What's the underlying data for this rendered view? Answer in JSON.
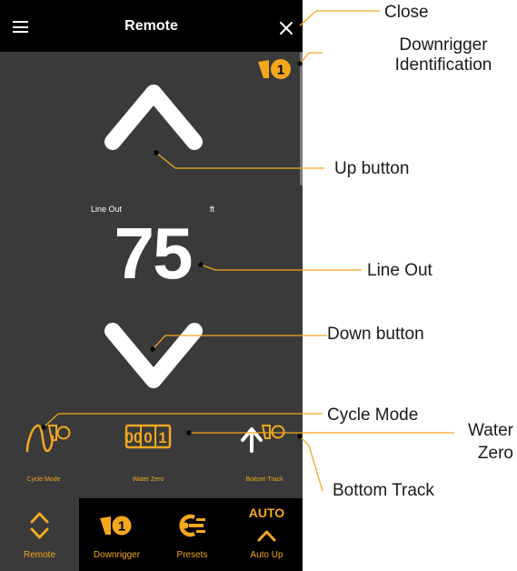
{
  "header": {
    "title": "Remote",
    "menu_icon": "hamburger-icon",
    "close_icon": "close-icon"
  },
  "downrigger_badge": {
    "number": "1"
  },
  "line_out": {
    "label": "Line Out",
    "unit": "ft",
    "value": "75"
  },
  "tools": [
    {
      "label": "Cycle Mode",
      "icon": "cycle-mode-icon"
    },
    {
      "label": "Water Zero",
      "icon": "water-zero-icon",
      "digits": "00",
      "digit_flip": "1"
    },
    {
      "label": "Bottom Track",
      "icon": "bottom-track-icon"
    }
  ],
  "nav": [
    {
      "label": "Remote",
      "icon": "remote-icon",
      "active": true
    },
    {
      "label": "Downrigger",
      "icon": "downrigger-icon",
      "badge": "1"
    },
    {
      "label": "Presets",
      "icon": "presets-icon"
    },
    {
      "label": "Auto Up",
      "icon": "auto-up-icon",
      "text": "AUTO"
    }
  ],
  "callouts": {
    "close": "Close",
    "downrigger_id": "Downrigger Identification",
    "downrigger_id_line1": "Downrigger",
    "downrigger_id_line2": "Identification",
    "up_button": "Up button",
    "line_out": "Line Out",
    "down_button": "Down button",
    "cycle_mode": "Cycle Mode",
    "water_zero_line1": "Water",
    "water_zero_line2": "Zero",
    "bottom_track": "Bottom Track"
  },
  "colors": {
    "accent": "#f4a81d",
    "background": "#3a3a3b",
    "bar": "#000000",
    "text": "#ffffff"
  }
}
